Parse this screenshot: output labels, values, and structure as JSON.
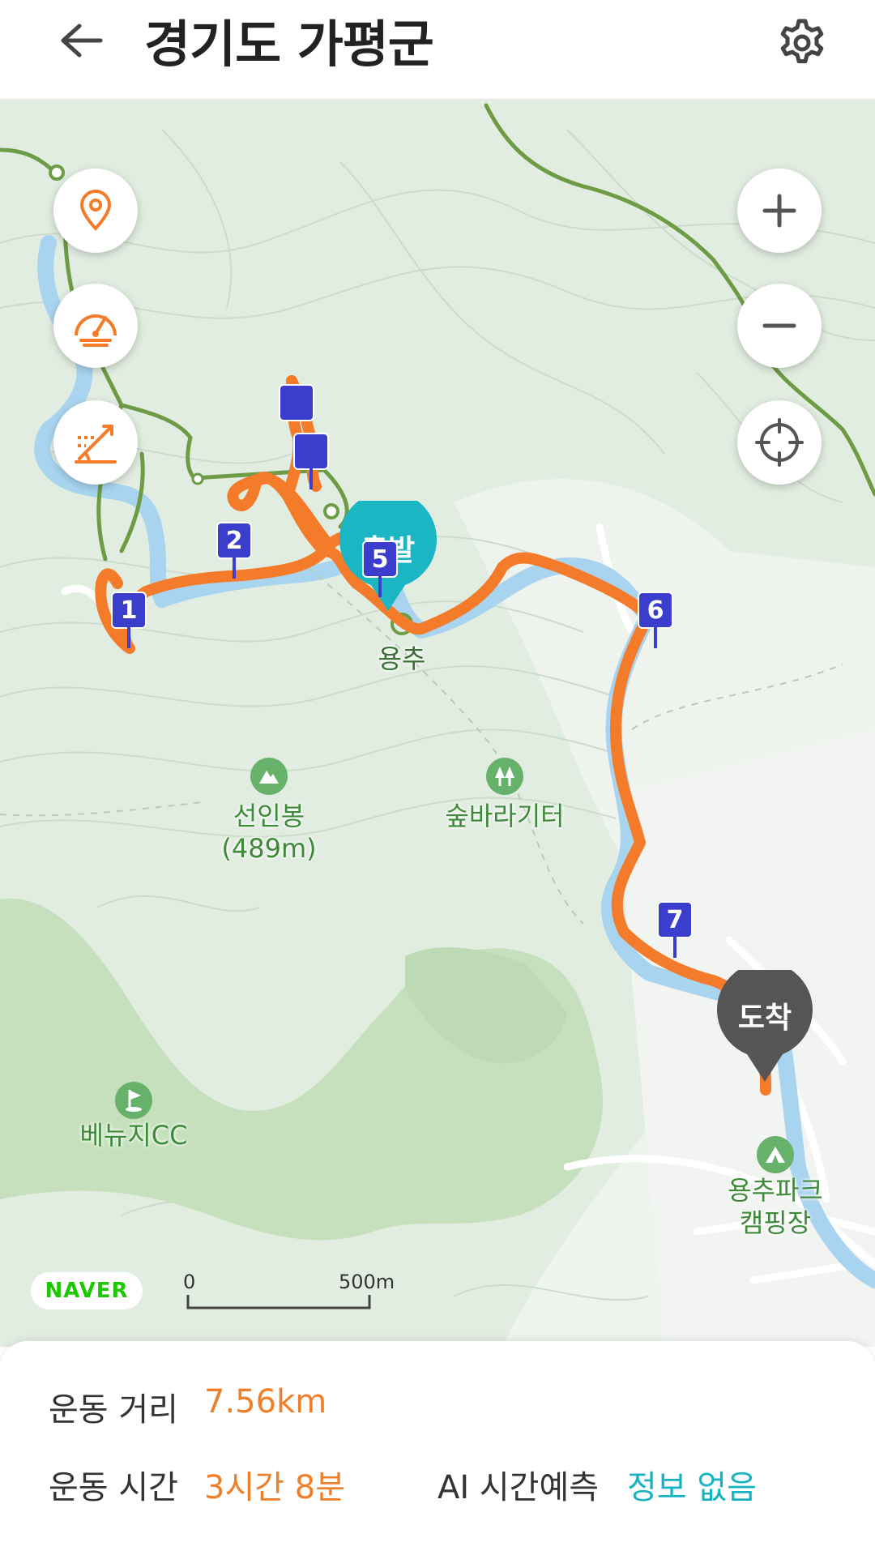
{
  "header": {
    "title": "경기도 가평군",
    "back_icon": "arrow-left-icon",
    "settings_icon": "gear-icon"
  },
  "map": {
    "labels": {
      "yongchu": "용추",
      "seoninbong": "선인봉",
      "seoninbong_elev": "(489m)",
      "forest_rest": "숲바라기터",
      "golf": "베뉴지CC",
      "camping_line1": "용추파크",
      "camping_line2": "캠핑장"
    },
    "pins": {
      "start": "출발",
      "end": "도착"
    },
    "waypoints": [
      "1",
      "2",
      "",
      "",
      "5",
      "6",
      "7"
    ],
    "naver_logo": "NAVER",
    "scale": {
      "start": "0",
      "end": "500m"
    },
    "colors": {
      "route": "#f47b2a",
      "river": "#a9d4ef",
      "trail": "#6e9b45",
      "start_pin": "#1bb6c4",
      "end_pin": "#555555",
      "waypoint": "#3b3dcc"
    },
    "left_controls": [
      "location-pin-icon",
      "speedometer-icon",
      "elevation-icon"
    ],
    "right_controls": [
      "zoom-in-icon",
      "zoom-out-icon",
      "crosshair-icon"
    ]
  },
  "stats": {
    "distance_label": "운동 거리",
    "distance_value": "7.56km",
    "time_label": "운동 시간",
    "time_value": "3시간 8분",
    "ai_label": "AI 시간예측",
    "ai_value": "정보 없음"
  }
}
